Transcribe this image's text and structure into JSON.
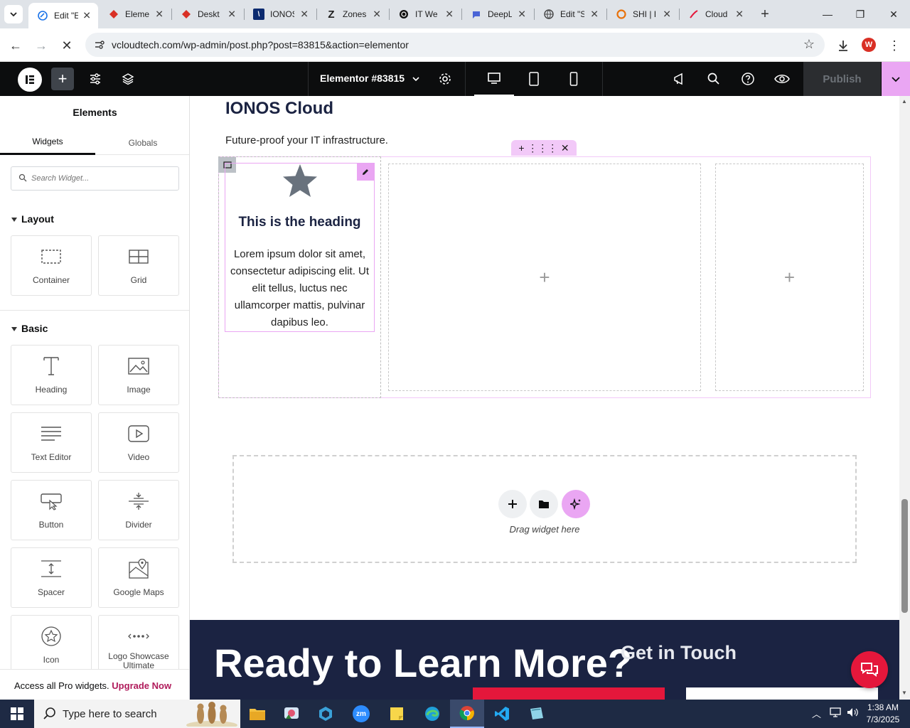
{
  "browser": {
    "tabs": [
      {
        "title": "Edit \"E",
        "icon": "edit-globe-icon",
        "color": "#1a73e8",
        "active": true
      },
      {
        "title": "Elemen",
        "icon": "gem-icon",
        "color": "#d93025"
      },
      {
        "title": "Deskt",
        "icon": "gem-icon",
        "color": "#d93025"
      },
      {
        "title": "IONOS",
        "icon": "ionos-icon",
        "color": "#0b2a6f"
      },
      {
        "title": "Zones",
        "icon": "z-icon",
        "color": "#111111"
      },
      {
        "title": "IT We",
        "icon": "openai-icon",
        "color": "#111111"
      },
      {
        "title": "DeepL",
        "icon": "deepl-icon",
        "color": "#4a64d6"
      },
      {
        "title": "Edit \"S",
        "icon": "globe-icon",
        "color": "#444444"
      },
      {
        "title": "SHI | I",
        "icon": "shi-icon",
        "color": "#e8710a"
      },
      {
        "title": "Cloud",
        "icon": "cloud-script-icon",
        "color": "#e4173b"
      }
    ],
    "url": "vcloudtech.com/wp-admin/post.php?post=83815&action=elementor",
    "profile_initial": "W"
  },
  "editor": {
    "document_title": "Elementor #83815",
    "publish_label": "Publish"
  },
  "panel": {
    "title": "Elements",
    "tabs": [
      "Widgets",
      "Globals"
    ],
    "search_placeholder": "Search Widget...",
    "categories": {
      "layout": "Layout",
      "basic": "Basic"
    },
    "widgets": {
      "container": "Container",
      "grid": "Grid",
      "heading": "Heading",
      "image": "Image",
      "text_editor": "Text Editor",
      "video": "Video",
      "button": "Button",
      "divider": "Divider",
      "spacer": "Spacer",
      "google_maps": "Google Maps",
      "icon": "Icon",
      "logo_showcase": "Logo Showcase Ultimate"
    },
    "promo_text": "Access all Pro widgets.",
    "promo_link": "Upgrade Now"
  },
  "canvas": {
    "section_title": "IONOS Cloud",
    "section_subtitle": "Future-proof your IT infrastructure.",
    "iconbox_heading": "This is the heading",
    "iconbox_text": "Lorem ipsum dolor sit amet, consectetur adipiscing elit. Ut elit tellus, luctus nec ullamcorper mattis, pulvinar dapibus leo.",
    "drag_text": "Drag widget here",
    "footer_heading": "Ready to Learn More?",
    "footer_get_in_touch": "Get in Touch",
    "colors": {
      "accent": "#eaa6f3",
      "navy": "#1b2342",
      "red": "#e4173b"
    }
  },
  "taskbar": {
    "search_placeholder": "Type here to search",
    "time": "1:38 AM",
    "date": "7/3/2025"
  }
}
